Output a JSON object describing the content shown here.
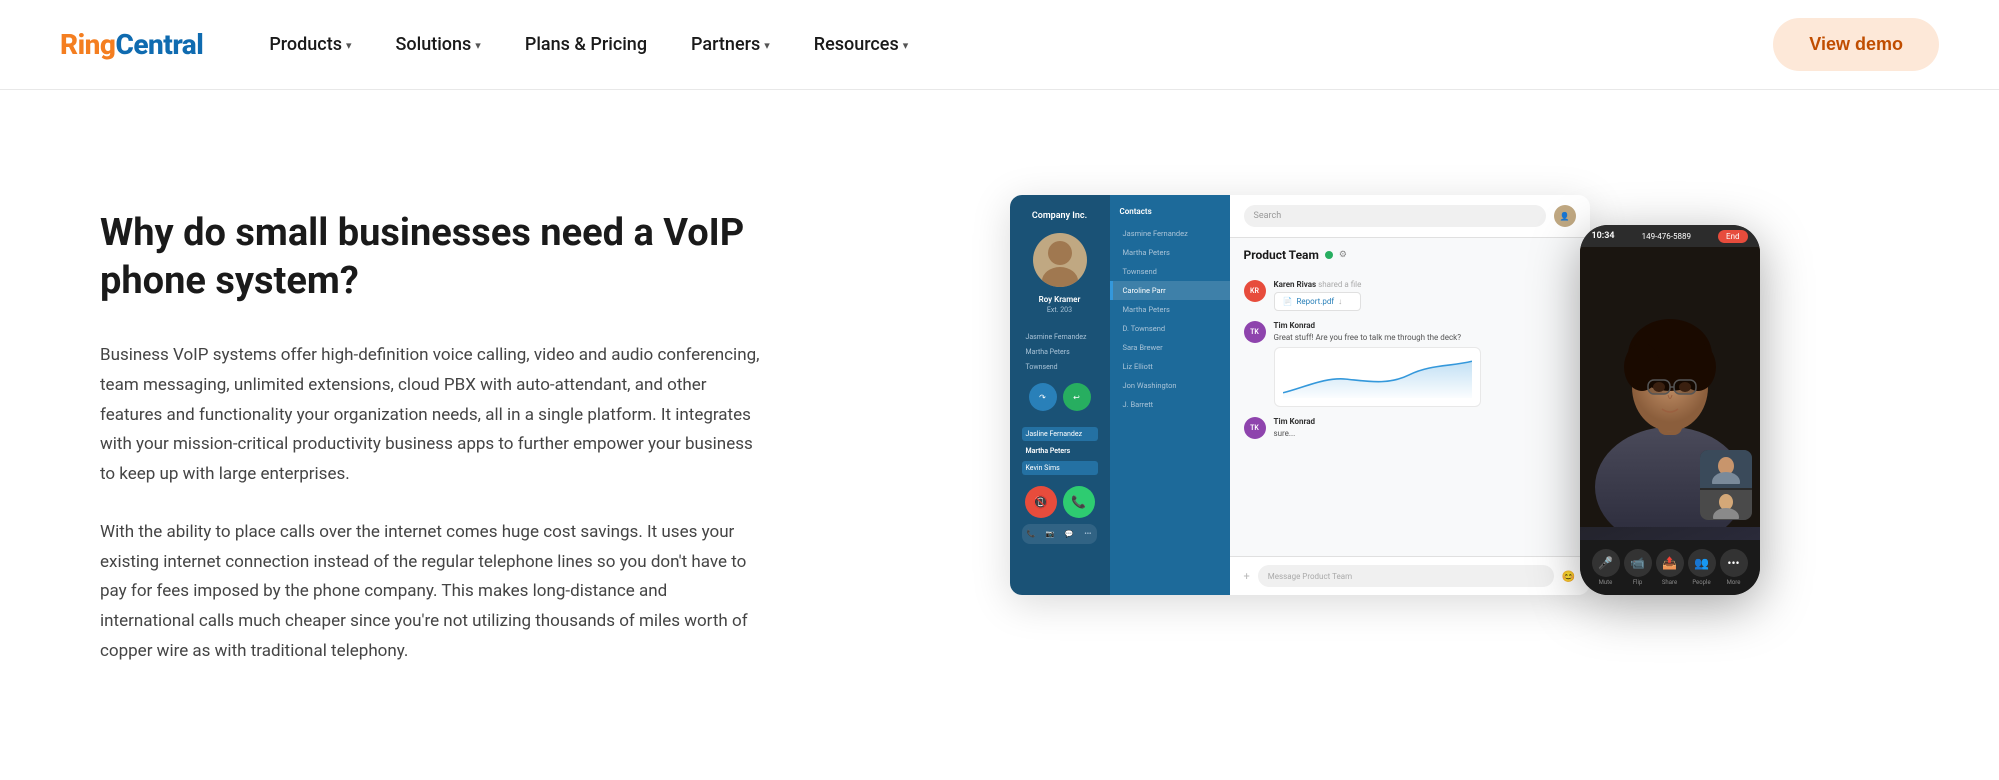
{
  "brand": {
    "ring": "Ring",
    "central": "Central"
  },
  "nav": {
    "items": [
      {
        "label": "Products",
        "hasDropdown": true
      },
      {
        "label": "Solutions",
        "hasDropdown": true
      },
      {
        "label": "Plans & Pricing",
        "hasDropdown": false
      },
      {
        "label": "Partners",
        "hasDropdown": true
      },
      {
        "label": "Resources",
        "hasDropdown": true
      }
    ],
    "cta_label": "View demo"
  },
  "main": {
    "heading": "Why do small businesses need a VoIP phone system?",
    "paragraph1": "Business VoIP systems offer high-definition voice calling, video and audio conferencing, team messaging, unlimited extensions, cloud PBX with auto-attendant, and other features and functionality your organization needs, all in a single platform. It integrates with your mission-critical productivity business apps to further empower your business to keep up with large enterprises.",
    "paragraph2": "With the ability to place calls over the internet comes huge cost savings. It uses your existing internet connection instead of the regular telephone lines so you don't have to pay for fees imposed by the phone company. This makes long-distance and international calls much cheaper since you're not utilizing thousands of miles worth of copper wire as with traditional telephony."
  },
  "app_mockup": {
    "company_name": "Company Inc.",
    "user_name": "Roy Kramer",
    "user_ext": "Ext. 203",
    "team_name": "Product Team",
    "search_placeholder": "Search",
    "contacts": [
      "Jasmine Fernandez",
      "Martha Peters",
      "Townsend",
      "Caroline Parr",
      "Martha Peters",
      "D. Townsend",
      "Sara Brewer",
      "Liz Elliott",
      "Jon Washington",
      "J. Barrett"
    ],
    "messages": [
      {
        "sender": "Karen Rivas",
        "initials": "KR",
        "text": "shared a file",
        "file": "Report.pdf"
      },
      {
        "sender": "Tim Konrad",
        "initials": "TK",
        "text": "Great stuff! Are you free to talk me through the deck?"
      },
      {
        "sender": "Tim Konrad",
        "initials": "TK",
        "text": "sure..."
      }
    ],
    "message_input_placeholder": "Message Product Team",
    "active_contact": "Kevin Sims",
    "active_contact_subtitle": "Martha Peters",
    "btn_forward": "Forward",
    "btn_reply": "Reply",
    "btn_to_voicemail": "To Voicemail",
    "btn_answer": "Answer"
  },
  "phone_mockup": {
    "time": "10:34",
    "call_number": "149-476-5889",
    "end_label": "End",
    "controls": [
      "Mute",
      "Flip Video",
      "Share Screen",
      "Participants"
    ]
  }
}
